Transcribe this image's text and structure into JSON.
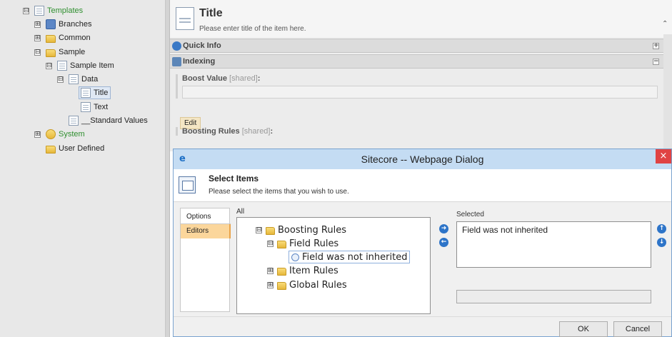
{
  "tree": {
    "templates": "Templates",
    "branches": "Branches",
    "common": "Common",
    "sample": "Sample",
    "sample_item": "Sample Item",
    "data": "Data",
    "title": "Title",
    "text": "Text",
    "standard_values": "__Standard Values",
    "system": "System",
    "user_defined": "User Defined",
    "expanded": "⊟",
    "collapsed": "⊞"
  },
  "editor": {
    "title": "Title",
    "subtitle": "Please enter title of the item here.",
    "sections": {
      "quick_info": "Quick Info",
      "indexing": "Indexing"
    },
    "fields": {
      "boost_value": "Boost Value",
      "boosting_rules": "Boosting Rules",
      "shared_tag": "[shared]",
      "colon": ":",
      "edit_button": "Edit"
    }
  },
  "dialog": {
    "window_title": "Sitecore -- Webpage Dialog",
    "close_glyph": "×",
    "header_title": "Select Items",
    "header_subtitle": "Please select the items that you wish to use.",
    "tabs": [
      "Options",
      "Editors"
    ],
    "all_label": "All",
    "selected_label": "Selected",
    "all_tree": {
      "boosting_rules": "Boosting Rules",
      "field_rules": "Field Rules",
      "field_not_inherited": "Field was not inherited",
      "item_rules": "Item Rules",
      "global_rules": "Global Rules"
    },
    "selected_items": [
      "Field was not inherited"
    ],
    "ok_label": "OK",
    "cancel_label": "Cancel"
  },
  "colors": {
    "dialog_titlebar": "#c4dcf3",
    "close_button": "#e04343",
    "active_tab": "#fbd69b",
    "green_text": "#2f8f2f",
    "arrow_blue": "#2d74c8"
  }
}
